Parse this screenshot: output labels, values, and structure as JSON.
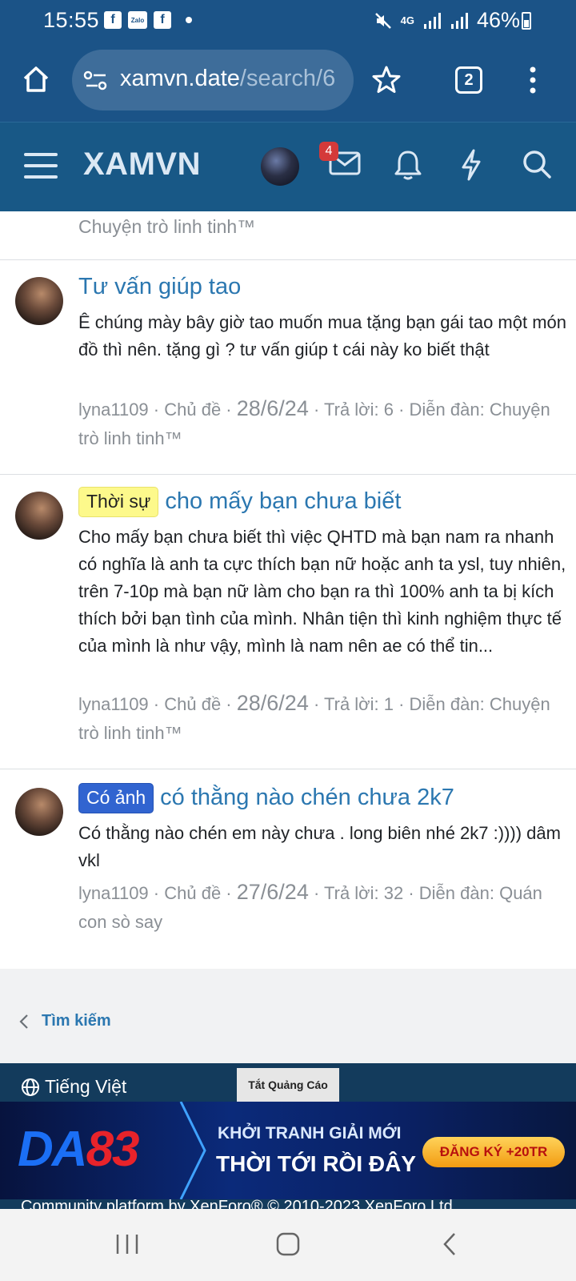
{
  "status_bar": {
    "time": "15:55",
    "network": "4G",
    "battery": "46%"
  },
  "browser": {
    "url_domain": "xamvn.date",
    "url_path": "/search/6",
    "tab_count": "2"
  },
  "forum_header": {
    "logo": "XAMVN",
    "inbox_badge": "4"
  },
  "previous_post_forum": "Chuyện trò linh tinh™",
  "posts": [
    {
      "prefix": "",
      "title": "Tư vấn giúp tao",
      "snippet": "Ê chúng mày bây giờ tao muốn mua tặng bạn gái tao một món đồ thì nên. tặng gì ? tư vấn giúp t cái này ko biết thật",
      "author": "lyna1109",
      "type": "Chủ đề",
      "date": "28/6/24",
      "replies": "Trả lời: 6",
      "forum_label": "Diễn đàn:",
      "forum": "Chuyện trò linh tinh™"
    },
    {
      "prefix": "Thời sự",
      "title": "cho mấy bạn chưa biết",
      "snippet": "Cho mấy bạn chưa biết thì việc QHTD mà bạn nam ra nhanh có nghĩa là anh ta cực thích bạn nữ hoặc anh ta ysl, tuy nhiên, trên 7-10p mà bạn nữ làm cho bạn ra thì 100% anh ta bị kích thích bởi bạn tình của mình. Nhân tiện thì kinh nghiệm thực tế của mình là như vậy, mình là nam nên ae có thể tin...",
      "author": "lyna1109",
      "type": "Chủ đề",
      "date": "28/6/24",
      "replies": "Trả lời: 1",
      "forum_label": "Diễn đàn:",
      "forum": "Chuyện trò linh tinh™"
    },
    {
      "prefix": "Có ảnh",
      "title": "có thằng nào chén chưa 2k7",
      "snippet": "Có thằng nào chén em này chưa . long biên nhé 2k7 :)))) dâm vkl",
      "author": "lyna1109",
      "type": "Chủ đề",
      "date": "27/6/24",
      "replies": "Trả lời: 32",
      "forum_label": "Diễn đàn:",
      "forum": "Quán con sò say"
    }
  ],
  "pager": {
    "back_label": "Tìm kiếm"
  },
  "footer": {
    "language": "Tiếng Việt",
    "ad_close": "Tắt Quảng Cáo",
    "ad": {
      "logo_blue": "DA",
      "logo_red": "83",
      "headline1": "KHỞI TRANH GIẢI MỚI",
      "headline2": "THỜI TỚI RỒI ĐÂY",
      "cta": "ĐĂNG KÝ +20TR"
    },
    "copyright": "Community platform by XenForo® © 2010-2023 XenForo Ltd."
  },
  "colors": {
    "header_blue": "#185886",
    "link_blue": "#2b77b0",
    "prefix_yellow": "#fdf98b",
    "prefix_blue": "#3164d0",
    "badge_red": "#d43a3a"
  }
}
